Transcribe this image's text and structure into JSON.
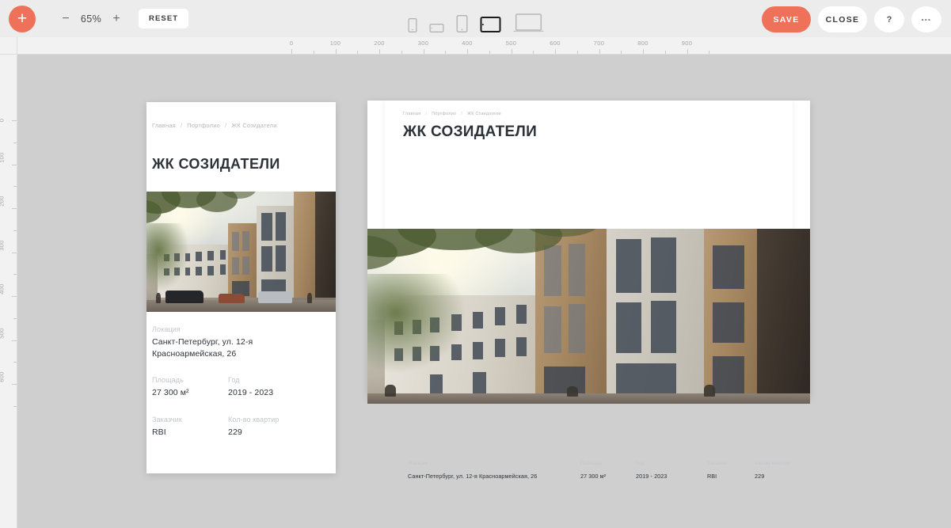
{
  "toolbar": {
    "add_label": "+",
    "zoom_out_label": "−",
    "zoom_value": "65%",
    "zoom_in_label": "+",
    "reset_label": "RESET",
    "save_label": "SAVE",
    "close_label": "CLOSE",
    "help_label": "?",
    "more_label": "…",
    "accent_color": "#ee7259",
    "devices": [
      {
        "name": "phone-small-portrait",
        "selected": false
      },
      {
        "name": "phone-landscape",
        "selected": false
      },
      {
        "name": "phone-large-portrait",
        "selected": false
      },
      {
        "name": "tablet-landscape",
        "selected": true
      },
      {
        "name": "laptop",
        "selected": false
      }
    ]
  },
  "rulers": {
    "horizontal_ticks": [
      "0",
      "100",
      "200",
      "300",
      "400",
      "500",
      "600",
      "700",
      "800",
      "900"
    ],
    "vertical_ticks": [
      "0",
      "100",
      "200",
      "300",
      "400",
      "500",
      "600"
    ],
    "unit_step": 100
  },
  "page": {
    "breadcrumb": {
      "home": "Главная",
      "section": "Портфолио",
      "current": "ЖК Созидатели",
      "separator": "/"
    },
    "title": "ЖК СОЗИДАТЕЛИ",
    "hero_alt": "architectural-render-street-facade",
    "details": {
      "location_label": "Локация",
      "location_value": "Санкт-Петербург, ул. 12-я Красноармейская, 26",
      "location_value_line1": "Санкт-Петербург, ул. 12-я",
      "location_value_line2": "Красноармейская, 26",
      "area_label": "Площадь",
      "area_value": "27 300 м²",
      "year_label": "Год",
      "year_value": "2019 - 2023",
      "customer_label": "Заказчик",
      "customer_value": "RBI",
      "apartments_label": "Кол-во квартир",
      "apartments_value": "229"
    }
  }
}
